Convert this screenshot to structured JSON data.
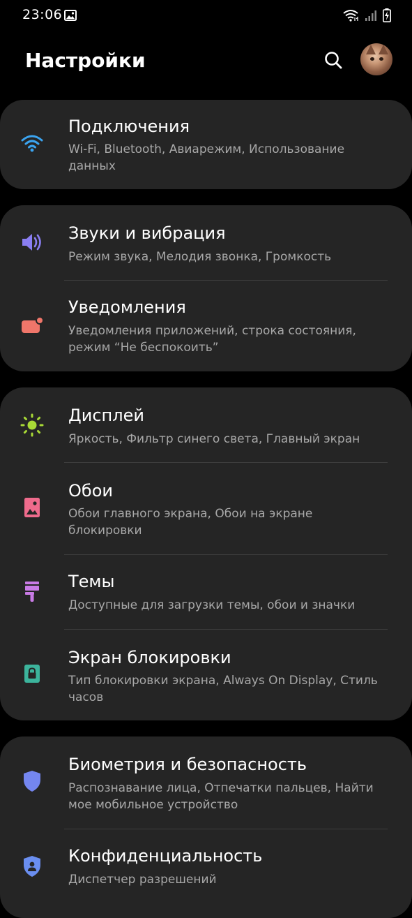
{
  "status_bar": {
    "time": "23:06"
  },
  "header": {
    "title": "Настройки"
  },
  "colors": {
    "background": "#000000",
    "card": "#252525",
    "subtitle": "#a8a8a8",
    "wifi": "#3ba4f0",
    "sound": "#8a7ef2",
    "notifications": "#f0766a",
    "display": "#a8d936",
    "wallpaper": "#ef6b8c",
    "themes": "#c97be6",
    "lockscreen": "#3cb49c",
    "biometrics": "#7486f0",
    "privacy": "#6a8ef0"
  },
  "sections": [
    {
      "items": [
        {
          "icon": "wifi-icon",
          "title": "Подключения",
          "subtitle": "Wi-Fi, Bluetooth, Авиарежим, Использование данных"
        }
      ]
    },
    {
      "items": [
        {
          "icon": "speaker-icon",
          "title": "Звуки и вибрация",
          "subtitle": "Режим звука, Мелодия звонка, Громкость"
        },
        {
          "icon": "notification-icon",
          "title": "Уведомления",
          "subtitle": "Уведомления приложений, строка состояния, режим “Не беспокоить”"
        }
      ]
    },
    {
      "items": [
        {
          "icon": "brightness-icon",
          "title": "Дисплей",
          "subtitle": "Яркость, Фильтр синего света, Главный экран"
        },
        {
          "icon": "wallpaper-icon",
          "title": "Обои",
          "subtitle": "Обои главного экрана, Обои на экране блокировки"
        },
        {
          "icon": "paintbrush-icon",
          "title": "Темы",
          "subtitle": "Доступные для загрузки темы, обои и значки"
        },
        {
          "icon": "lock-icon",
          "title": "Экран блокировки",
          "subtitle": "Тип блокировки экрана, Always On Display, Стиль часов"
        }
      ]
    },
    {
      "items": [
        {
          "icon": "shield-icon",
          "title": "Биометрия и безопасность",
          "subtitle": "Распознавание лица, Отпечатки пальцев, Найти мое мобильное устройство"
        },
        {
          "icon": "privacy-shield-icon",
          "title": "Конфиденциальность",
          "subtitle": "Диспетчер разрешений"
        }
      ]
    }
  ]
}
